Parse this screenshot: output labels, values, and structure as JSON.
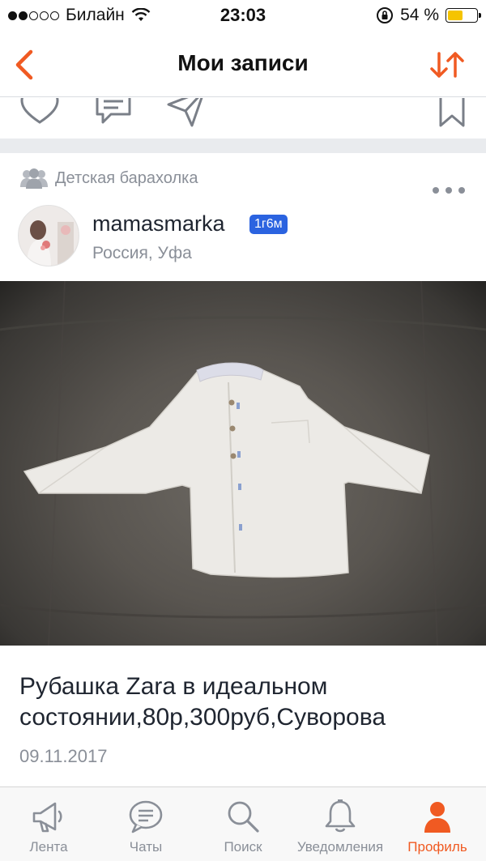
{
  "status_bar": {
    "carrier": "Билайн",
    "time": "23:03",
    "battery_percent": "54 %",
    "signal_bars_filled": 2,
    "signal_bars_total": 5,
    "battery_level": 0.54
  },
  "nav": {
    "title": "Мои записи",
    "back_icon": "chevron-left-icon",
    "sort_icon": "sort-arrows-icon"
  },
  "post": {
    "group": "Детская барахолка",
    "author": {
      "username": "mamasmarka",
      "badge": "1г6м",
      "location": "Россия, Уфа"
    },
    "text": "Рубашка Zara в идеальном состоянии,80р,300руб,Суворова",
    "date": "09.11.2017"
  },
  "tabs": [
    {
      "label": "Лента",
      "icon": "megaphone-icon",
      "active": false
    },
    {
      "label": "Чаты",
      "icon": "chat-bubble-icon",
      "active": false
    },
    {
      "label": "Поиск",
      "icon": "search-icon",
      "active": false
    },
    {
      "label": "Уведомления",
      "icon": "bell-icon",
      "active": false
    },
    {
      "label": "Профиль",
      "icon": "person-icon",
      "active": true
    }
  ],
  "colors": {
    "accent": "#f05a22",
    "badge": "#2b63e0",
    "muted_text": "#8a8f98",
    "battery": "#f5c400"
  }
}
